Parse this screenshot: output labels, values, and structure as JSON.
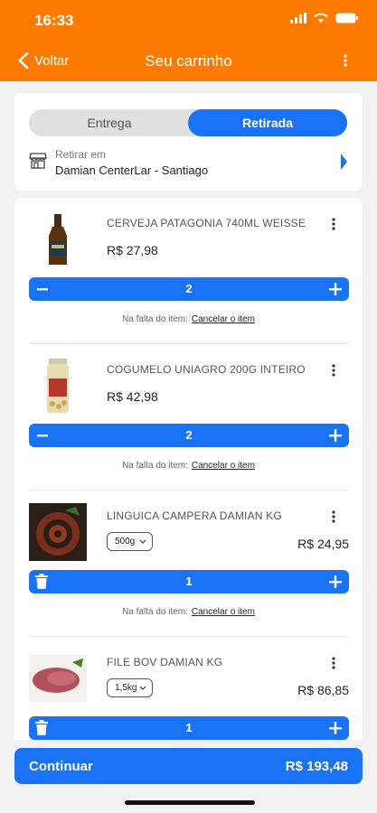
{
  "status_bar": {
    "time": "16:33"
  },
  "header": {
    "back_label": "Voltar",
    "title": "Seu carrinho"
  },
  "mode": {
    "options": [
      "Entrega",
      "Retirada"
    ],
    "selected": "Retirada",
    "pickup_label": "Retirar em",
    "pickup_store": "Damian CenterLar - Santiago"
  },
  "items": [
    {
      "name": "CERVEJA PATAGONIA 740ML WEISSE",
      "price": "R$ 27,98",
      "quantity": "2",
      "missing_label": "Na falta do item:",
      "missing_action": "Cancelar o item"
    },
    {
      "name": "COGUMELO UNIAGRO 200G INTEIRO",
      "price": "R$ 42,98",
      "quantity": "2",
      "missing_label": "Na falta do item:",
      "missing_action": "Cancelar o item"
    },
    {
      "name": "LINGUICA CAMPERA DAMIAN KG",
      "weight": "500g",
      "price": "R$ 24,95",
      "quantity": "1",
      "missing_label": "Na falta do item:",
      "missing_action": "Cancelar o item"
    },
    {
      "name": "FILE BOV DAMIAN KG",
      "weight": "1,5kg",
      "price": "R$ 86,85",
      "quantity": "1"
    }
  ],
  "footer": {
    "continue_label": "Continuar",
    "total": "R$ 193,48"
  },
  "colors": {
    "header": "#ff7a00",
    "accent": "#1a73f5"
  }
}
